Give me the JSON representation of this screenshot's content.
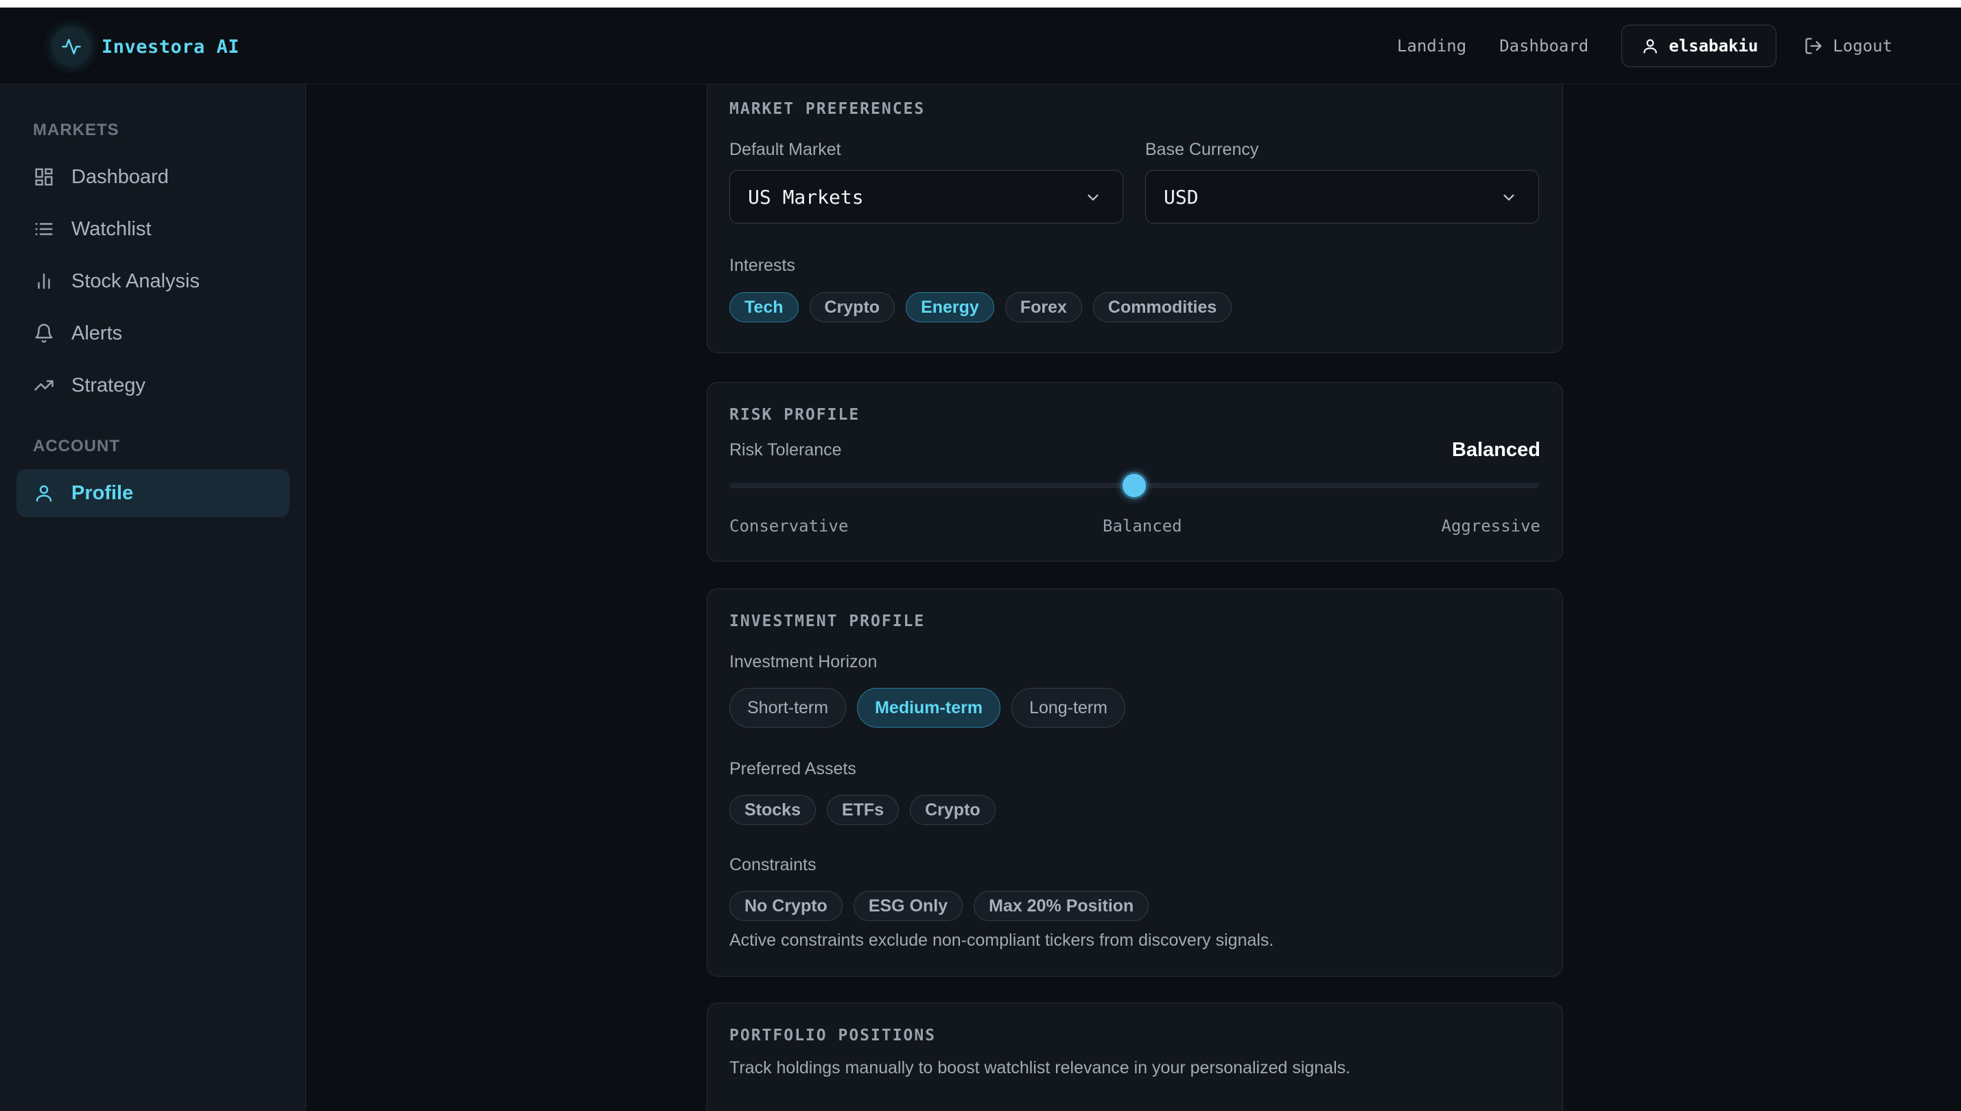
{
  "brand": {
    "name": "Investora AI",
    "icon": "activity-pulse-icon"
  },
  "topnav": {
    "links": [
      "Landing",
      "Dashboard"
    ],
    "username": "elsabakiu",
    "logout": "Logout"
  },
  "sidebar": {
    "markets_heading": "MARKETS",
    "account_heading": "ACCOUNT",
    "items": [
      {
        "label": "Dashboard",
        "icon": "grid-icon"
      },
      {
        "label": "Watchlist",
        "icon": "list-icon"
      },
      {
        "label": "Stock Analysis",
        "icon": "bar-chart-icon"
      },
      {
        "label": "Alerts",
        "icon": "bell-icon"
      },
      {
        "label": "Strategy",
        "icon": "trending-up-icon"
      },
      {
        "label": "Profile",
        "icon": "user-icon",
        "active": true
      }
    ]
  },
  "market_preferences": {
    "title": "MARKET PREFERENCES",
    "default_market_label": "Default Market",
    "default_market_value": "US Markets",
    "base_currency_label": "Base Currency",
    "base_currency_value": "USD",
    "interests_label": "Interests",
    "interests": [
      {
        "label": "Tech",
        "selected": true
      },
      {
        "label": "Crypto",
        "selected": false
      },
      {
        "label": "Energy",
        "selected": true
      },
      {
        "label": "Forex",
        "selected": false
      },
      {
        "label": "Commodities",
        "selected": false
      }
    ]
  },
  "risk_profile": {
    "title": "RISK PROFILE",
    "tolerance_label": "Risk Tolerance",
    "tolerance_value": "Balanced",
    "slider_level": 0.5,
    "scale": [
      "Conservative",
      "Balanced",
      "Aggressive"
    ]
  },
  "investment_profile": {
    "title": "INVESTMENT PROFILE",
    "horizon_label": "Investment Horizon",
    "horizons": [
      {
        "label": "Short-term",
        "selected": false
      },
      {
        "label": "Medium-term",
        "selected": true
      },
      {
        "label": "Long-term",
        "selected": false
      }
    ],
    "assets_label": "Preferred Assets",
    "assets": [
      "Stocks",
      "ETFs",
      "Crypto"
    ],
    "constraints_label": "Constraints",
    "constraints": [
      "No Crypto",
      "ESG Only",
      "Max 20% Position"
    ],
    "constraints_note": "Active constraints exclude non-compliant tickers from discovery signals."
  },
  "portfolio_positions": {
    "title": "PORTFOLIO POSITIONS",
    "description": "Track holdings manually to boost watchlist relevance in your personalized signals."
  },
  "colors": {
    "accent": "#5ed7f2",
    "background": "#0b0e13",
    "card": "#12161d"
  }
}
